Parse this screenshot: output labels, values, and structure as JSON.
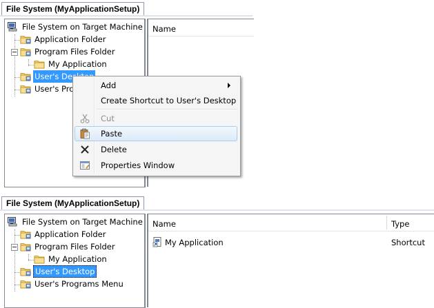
{
  "top": {
    "tab_title": "File System (MyApplicationSetup)",
    "tree": [
      {
        "label": "File System on Target Machine",
        "icon": "computer-icon"
      },
      {
        "label": "Application Folder",
        "icon": "folder-icon"
      },
      {
        "label": "Program Files Folder",
        "icon": "folder-icon"
      },
      {
        "label": "My Application",
        "icon": "folder-icon"
      },
      {
        "label": "User's Desktop",
        "icon": "folder-icon"
      },
      {
        "label": "User's Progr",
        "icon": "folder-icon"
      }
    ],
    "list": {
      "col_name": "Name"
    },
    "context_menu": [
      {
        "label": "Add",
        "icon": "",
        "has_submenu": true
      },
      {
        "label": "Create Shortcut to User's Desktop",
        "icon": ""
      },
      {
        "label": "Cut",
        "icon": "scissors-icon",
        "disabled": true
      },
      {
        "label": "Paste",
        "icon": "clipboard-icon",
        "hover": true
      },
      {
        "label": "Delete",
        "icon": "delete-x-icon"
      },
      {
        "label": "Properties Window",
        "icon": "properties-icon"
      }
    ]
  },
  "bottom": {
    "tab_title": "File System (MyApplicationSetup)",
    "tree": [
      {
        "label": "File System on Target Machine",
        "icon": "computer-icon"
      },
      {
        "label": "Application Folder",
        "icon": "folder-icon"
      },
      {
        "label": "Program Files Folder",
        "icon": "folder-icon"
      },
      {
        "label": "My Application",
        "icon": "folder-icon"
      },
      {
        "label": "User's Desktop",
        "icon": "folder-icon"
      },
      {
        "label": "User's Programs Menu",
        "icon": "folder-icon"
      }
    ],
    "list": {
      "col_name": "Name",
      "col_type": "Type",
      "rows": [
        {
          "name": "My Application",
          "type": "Shortcut",
          "icon": "shortcut-icon"
        }
      ]
    }
  },
  "colors": {
    "selection": "#3399ff",
    "folder": "#f3c969",
    "border": "#828790"
  }
}
